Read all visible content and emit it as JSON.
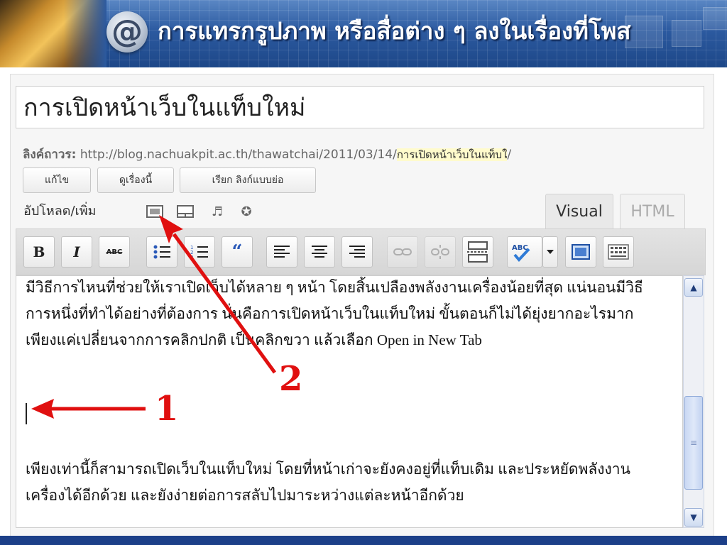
{
  "slide": {
    "title": "การแทรกรูปภาพ หรือสื่อต่าง ๆ ลงในเรื่องที่โพส",
    "icon": "at-icon",
    "colors": {
      "banner": "#2c5aa0",
      "bottom_bar": "#1c3f88",
      "annotation": "#e01010"
    }
  },
  "editor": {
    "post_title": "การเปิดหน้าเว็บในแท็บใหม่",
    "permalink": {
      "label": "ลิงค์ถาวร:",
      "url": "http://blog.nachuakpit.ac.th/thawatchai/2011/03/14/",
      "slug": "การเปิดหน้าเว็บในแท็บใ",
      "trailing": "/"
    },
    "buttons": {
      "edit": "แก้ไข",
      "view": "ดูเรื่องนี้",
      "shortlink": "เรียก ลิงก์แบบย่อ"
    },
    "upload": {
      "label": "อัปโหลด/เพิ่ม",
      "icons": [
        "image-icon",
        "video-icon",
        "audio-icon",
        "media-icon"
      ]
    },
    "tabs": {
      "visual": "Visual",
      "html": "HTML"
    },
    "toolbar": {
      "bold": "B",
      "italic": "I",
      "strike": "ABC",
      "buttons": [
        "bold",
        "italic",
        "strikethrough",
        "bullet-list",
        "numbered-list",
        "blockquote",
        "align-left",
        "align-center",
        "align-right",
        "link",
        "unlink",
        "more",
        "spellcheck",
        "fullscreen",
        "kitchen-sink"
      ]
    },
    "content": {
      "paragraph1": "มีวิธีการไหนที่ช่วยให้เราเปิดเว็บได้หลาย ๆ หน้า โดยสิ้นเปลืองพลังงานเครื่องน้อยที่สุด แน่นอนมีวิธีการหนึ่งที่ทำได้อย่างที่ต้องการ นั่นคือการเปิดหน้าเว็บในแท็บใหม่ ขั้นตอนก็ไม่ได้ยุ่งยากอะไรมาก เพียงแค่เปลี่ยนจากการคลิกปกติ เป็นคลิกขวา แล้วเลือก Open in New Tab",
      "paragraph2": "เพียงเท่านี้ก็สามารถเปิดเว็บในแท็บใหม่ โดยที่หน้าเก่าจะยังคงอยู่ที่แท็บเดิม และประหยัดพลังงานเครื่องได้อีกด้วย และยังง่ายต่อการสลับไปมาระหว่างแต่ละหน้าอีกด้วย"
    }
  },
  "annotations": {
    "one": "1",
    "two": "2"
  }
}
